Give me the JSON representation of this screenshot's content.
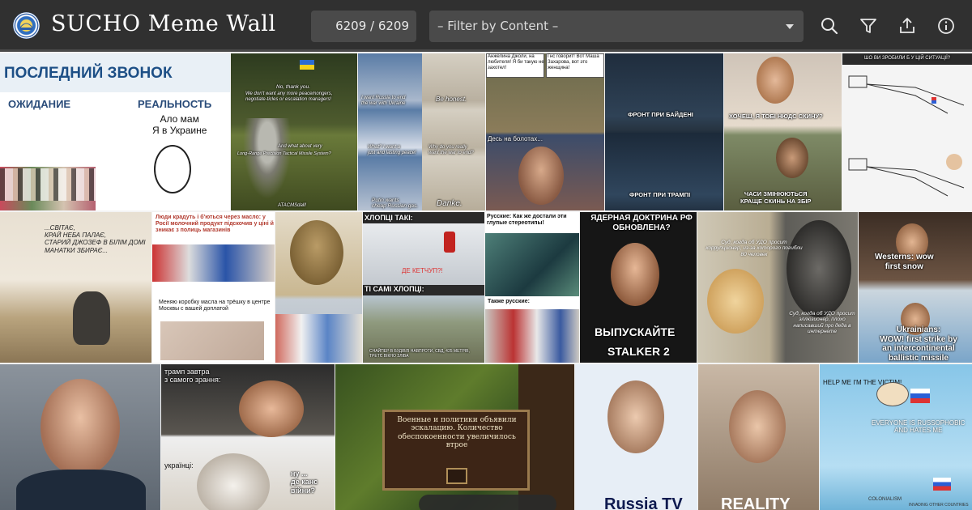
{
  "app": {
    "title": "SUCHO Meme Wall",
    "logo_icon": "sucho-logo-icon"
  },
  "toolbar": {
    "counter": "6209 / 6209",
    "filter_placeholder": "– Filter by Content –",
    "icons": [
      "search-icon",
      "filter-icon",
      "share-icon",
      "info-icon"
    ]
  },
  "tiles": [
    {
      "lines": [
        "ПОСЛЕДНИЙ ЗВОНОК",
        "ОЖИДАНИЕ",
        "РЕАЛЬНОСТЬ",
        "Ало мам",
        "Я в Украине"
      ]
    },
    {
      "lines": [
        "No, thank you.",
        "We don't want any more peacemongers,",
        "negotiate-ticles or escalation managers!",
        "And what about very",
        "Long-Range Precision Tactical Missile System?",
        "ATACMSdall!"
      ]
    },
    {
      "lines": [
        "I want Russia to end",
        "the war with Ukraine",
        "Be honest.",
        "What? I want a",
        "just and lasting peace!",
        "Why do you really",
        "want the war to end?",
        "Putin wants",
        "cheap Russian gas.",
        "Danke."
      ]
    },
    {
      "lines": [
        "Анжелина Джоли, на любителя! Я би такую не захотел!",
        "Гнс говорит! Вот Маша Захарова, вот это женщина!",
        "Десь на болотах..."
      ]
    },
    {
      "lines": [
        "ФРОНТ ПРИ БАЙДЕНІ",
        "ФРОНТ ПРИ ТРАМПІ"
      ]
    },
    {
      "lines": [
        "ХОЧЕШ, Я ТОБІ НЮДС СКИНУ?",
        "ЧАСИ ЗМІНЮЮТЬСЯ",
        "КРАЩЕ СКИНЬ НА ЗБІР"
      ]
    },
    {
      "lines": [
        "ШО ВИ ЗРОБИЛИ Б У ЦІЙ СИТУАЦІЇ?"
      ]
    },
    {
      "lines": [
        "...СВІТАЄ,",
        "КРАЙ НЕБА ПАЛАЄ,",
        "СТАРИЙ ДЖОЗЕФ В БІЛІМ ДОМІ",
        "МАНАТКИ ЗБИРАЄ..."
      ]
    },
    {
      "lines": [
        "Люди крадуть і б'ються через масло: у Росії молочний продукт підскочив у ціні й зникає з полиць магазинів",
        "Меняю коробку масла на трёшку в центре Москвы с вашей доплатой"
      ]
    },
    {
      "lines": [
        "ХЛОПЦІ ТАКІ:",
        "ДЕ КЕТЧУП?!",
        "ТІ САМІ ХЛОПЦІ:",
        "СНАЙПЕР В БУДІВЛІ НАВПРОТИ, СВД, 425 МЕТРІВ, ТРЕТЄ ВІКНО ЗЛІВА"
      ]
    },
    {
      "lines": [
        "Русские: Как же достали эти глупые стереотипы!",
        "Также русские:"
      ]
    },
    {
      "lines": [
        "ЯДЕРНАЯ ДОКТРИНА РФ ОБНОВЛЕНА?",
        "ВЫПУСКАЙТЕ",
        "STALKER 2"
      ]
    },
    {
      "lines": [
        "Суд, когда об УДО просит коррупционер, из-за которого погибли 80 человек",
        "Суд, когда об УДО просит эллюзионер, плохо написавший про деда в интернете"
      ]
    },
    {
      "lines": [
        "Westerns: wow",
        "first snow",
        "Ukrainians:",
        "WOW! first strike by",
        "an intercontinental",
        "ballistic missile"
      ]
    },
    {
      "lines": []
    },
    {
      "lines": [
        "трамп завтра",
        "з самого зрання:",
        "укрaїнці:",
        "ну ...",
        "де канс",
        "війни?"
      ]
    },
    {
      "lines": [
        "Военные и политики объявили эскалацию. Количество обеспокоенности увеличилось втрое"
      ]
    },
    {
      "lines": [
        "Russia TV",
        "REALITY"
      ]
    },
    {
      "lines": [
        "HELP ME I'M THE VICTIM!",
        "EVERYONE IS RUSSOPHOBIC",
        "AND HATES ME",
        "COLONIALISM",
        "INVADING OTHER COUNTRIES"
      ]
    }
  ]
}
